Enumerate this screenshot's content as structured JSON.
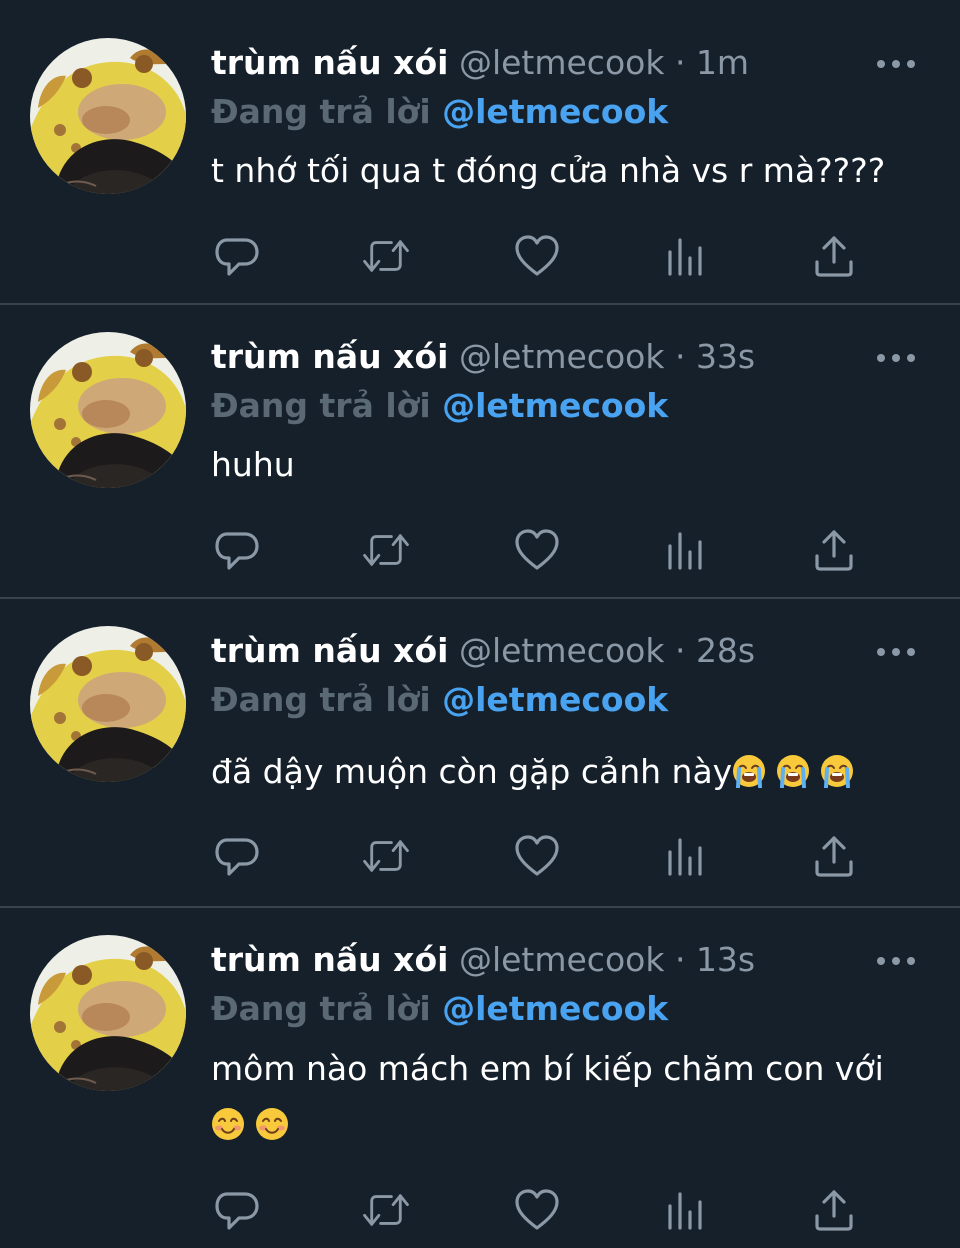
{
  "tweets": [
    {
      "name": "trùm nấu xói",
      "handle": "@letmecook",
      "separator": "·",
      "time": "1m",
      "reply_prefix": "Đang trả lời",
      "reply_to": "@letmecook",
      "text": "t nhớ tối qua t đóng cửa nhà vs r mà????",
      "emojis": []
    },
    {
      "name": "trùm nấu xói",
      "handle": "@letmecook",
      "separator": "·",
      "time": "33s",
      "reply_prefix": "Đang trả lời",
      "reply_to": "@letmecook",
      "text": "huhu",
      "emojis": []
    },
    {
      "name": "trùm nấu xói",
      "handle": "@letmecook",
      "separator": "·",
      "time": "28s",
      "reply_prefix": "Đang trả lời",
      "reply_to": "@letmecook",
      "text": "đã dậy muộn còn gặp cảnh này",
      "emojis": [
        "loudly-crying-face",
        "loudly-crying-face",
        "loudly-crying-face"
      ]
    },
    {
      "name": "trùm nấu xói",
      "handle": "@letmecook",
      "separator": "·",
      "time": "13s",
      "reply_prefix": "Đang trả lời",
      "reply_to": "@letmecook",
      "text": "môm nào mách em bí kiếp chăm con với",
      "emojis": [
        "smiling-face-with-smiling-eyes",
        "smiling-face-with-smiling-eyes"
      ]
    }
  ],
  "icons": {
    "more": "more-horizontal-icon",
    "reply": "reply-icon",
    "retweet": "retweet-icon",
    "like": "like-icon",
    "analytics": "analytics-icon",
    "share": "share-icon"
  },
  "colors": {
    "background": "#15202b",
    "divider": "#38444d",
    "secondary_text": "#8b98a5",
    "reply_prefix": "#5b6975",
    "link": "#4aa3f0",
    "icon": "#8b98a5"
  }
}
